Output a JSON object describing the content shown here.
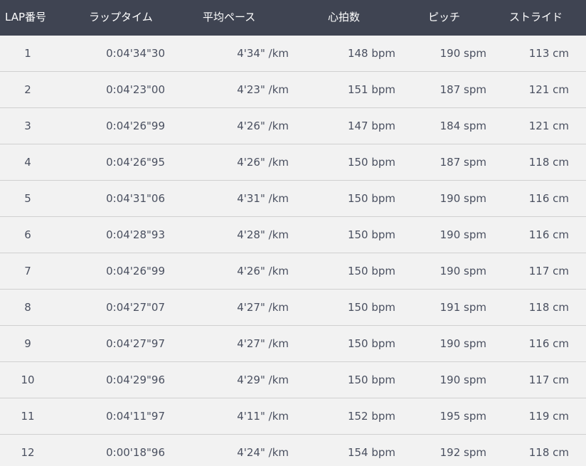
{
  "table": {
    "headers": {
      "lap": "LAP番号",
      "time": "ラップタイム",
      "pace": "平均ペース",
      "heart_rate": "心拍数",
      "pitch": "ピッチ",
      "stride": "ストライド"
    },
    "rows": [
      {
        "lap": "1",
        "time": "0:04'34\"30",
        "pace": "4'34\" /km",
        "heart_rate": "148 bpm",
        "pitch": "190 spm",
        "stride": "113 cm"
      },
      {
        "lap": "2",
        "time": "0:04'23\"00",
        "pace": "4'23\" /km",
        "heart_rate": "151 bpm",
        "pitch": "187 spm",
        "stride": "121 cm"
      },
      {
        "lap": "3",
        "time": "0:04'26\"99",
        "pace": "4'26\" /km",
        "heart_rate": "147 bpm",
        "pitch": "184 spm",
        "stride": "121 cm"
      },
      {
        "lap": "4",
        "time": "0:04'26\"95",
        "pace": "4'26\" /km",
        "heart_rate": "150 bpm",
        "pitch": "187 spm",
        "stride": "118 cm"
      },
      {
        "lap": "5",
        "time": "0:04'31\"06",
        "pace": "4'31\" /km",
        "heart_rate": "150 bpm",
        "pitch": "190 spm",
        "stride": "116 cm"
      },
      {
        "lap": "6",
        "time": "0:04'28\"93",
        "pace": "4'28\" /km",
        "heart_rate": "150 bpm",
        "pitch": "190 spm",
        "stride": "116 cm"
      },
      {
        "lap": "7",
        "time": "0:04'26\"99",
        "pace": "4'26\" /km",
        "heart_rate": "150 bpm",
        "pitch": "190 spm",
        "stride": "117 cm"
      },
      {
        "lap": "8",
        "time": "0:04'27\"07",
        "pace": "4'27\" /km",
        "heart_rate": "150 bpm",
        "pitch": "191 spm",
        "stride": "118 cm"
      },
      {
        "lap": "9",
        "time": "0:04'27\"97",
        "pace": "4'27\" /km",
        "heart_rate": "150 bpm",
        "pitch": "190 spm",
        "stride": "116 cm"
      },
      {
        "lap": "10",
        "time": "0:04'29\"96",
        "pace": "4'29\" /km",
        "heart_rate": "150 bpm",
        "pitch": "190 spm",
        "stride": "117 cm"
      },
      {
        "lap": "11",
        "time": "0:04'11\"97",
        "pace": "4'11\" /km",
        "heart_rate": "152 bpm",
        "pitch": "195 spm",
        "stride": "119 cm"
      },
      {
        "lap": "12",
        "time": "0:00'18\"96",
        "pace": "4'24\" /km",
        "heart_rate": "154 bpm",
        "pitch": "192 spm",
        "stride": "118 cm"
      }
    ]
  },
  "colors": {
    "header_background": "#3f4452",
    "header_text": "#ffffff",
    "row_background": "#f2f2f2",
    "row_text": "#4a5060",
    "divider": "#d0d0d0"
  }
}
